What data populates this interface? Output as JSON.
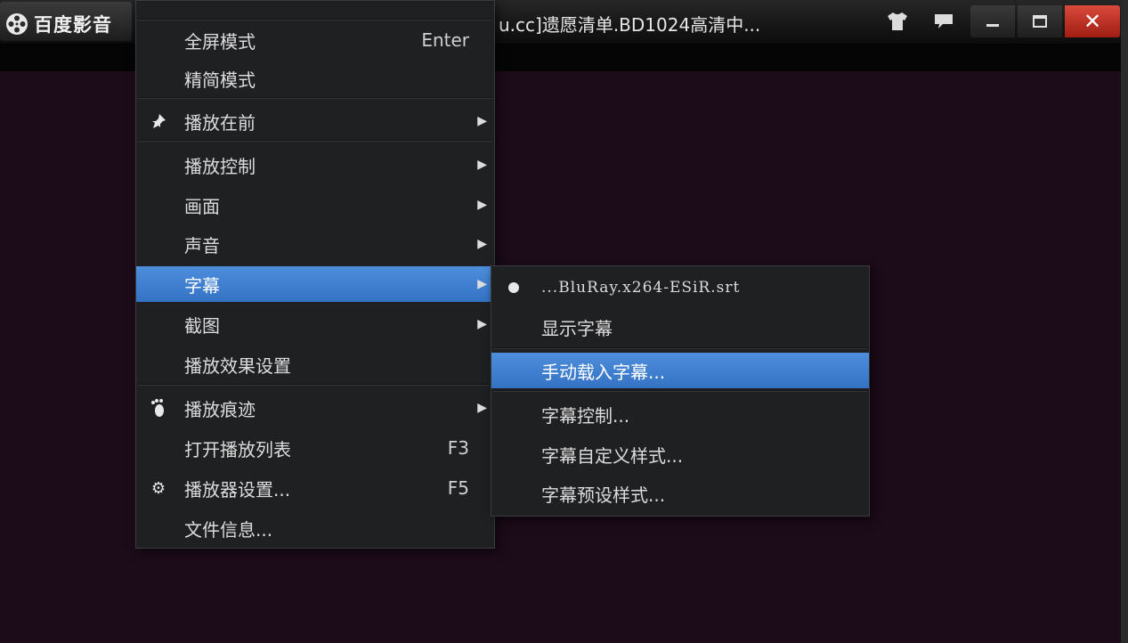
{
  "app": {
    "name": "百度影音",
    "window_title": "u.cc]遗愿清单.BD1024高清中..."
  },
  "main_menu": {
    "items": [
      {
        "label": "全屏模式",
        "shortcut": "Enter"
      },
      {
        "label": "精简模式"
      },
      {
        "label": "播放在前",
        "icon": "pin-icon",
        "submenu": true
      },
      {
        "label": "播放控制",
        "submenu": true
      },
      {
        "label": "画面",
        "submenu": true
      },
      {
        "label": "声音",
        "submenu": true
      },
      {
        "label": "字幕",
        "submenu": true,
        "highlighted": true
      },
      {
        "label": "截图",
        "submenu": true
      },
      {
        "label": "播放效果设置"
      },
      {
        "label": "播放痕迹",
        "icon": "footprint-icon",
        "submenu": true
      },
      {
        "label": "打开播放列表",
        "shortcut": "F3"
      },
      {
        "label": "播放器设置...",
        "icon": "gear-icon",
        "shortcut": "F5"
      },
      {
        "label": "文件信息..."
      }
    ]
  },
  "subtitle_menu": {
    "items": [
      {
        "label": "...BluRay.x264-ESiR.srt",
        "selected": true
      },
      {
        "label": "显示字幕"
      },
      {
        "label": "手动载入字幕...",
        "highlighted": true
      },
      {
        "label": "字幕控制..."
      },
      {
        "label": "字幕自定义样式..."
      },
      {
        "label": "字幕预设样式..."
      }
    ]
  },
  "colors": {
    "highlight": "#3f80d0",
    "menu_bg": "#1f2022",
    "video_bg": "#1c0b19",
    "close_red": "#c2301f"
  }
}
